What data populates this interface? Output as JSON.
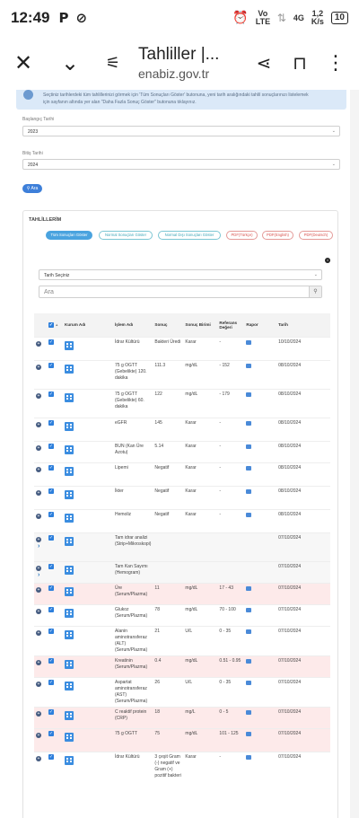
{
  "status_bar": {
    "time": "12:49",
    "left_icons": [
      "P",
      "⊘"
    ],
    "network": "Vo LTE",
    "signal": "4G",
    "speed_value": "1,2",
    "speed_unit": "K/s",
    "battery": "10"
  },
  "browser": {
    "title": "Tahliller |...",
    "url": "enabiz.gov.tr",
    "icons": [
      "close-icon",
      "chevron-down-icon",
      "page-settings-icon",
      "share-icon",
      "bookmark-icon",
      "more-vert-icon"
    ]
  },
  "info": {
    "line1": "Seçtiniz tarihlerdeki tüm tahlillerinizi görmek için 'Tüm Sonuçları Göster' butonuna, yeni tarih aralığındaki tahlil sonuçlarınızı listelemek",
    "line2": "için sayfanın altında yer alan \"Daha Fazla Sonuç Göster\" butonuna tıklayınız."
  },
  "filters": {
    "start_label": "Başlangıç Tarihi",
    "start_value": "2023",
    "end_label": "Bitiş Tarihi",
    "end_value": "2024",
    "search_button": "Ara"
  },
  "panel": {
    "title": "TAHLİLLERİM",
    "tags": [
      "Tüm Sonuçları Göster",
      "Normal Sonuçları Göster",
      "Normal Dışı Sonuçları Göster",
      "PDF(Türkçe)",
      "PDF(English)",
      "PDF(Deutsch)"
    ],
    "date_select": "Tarih Seçiniz",
    "search_placeholder": "Ara"
  },
  "table": {
    "headers": {
      "kurum": "Kurum Adı",
      "islem": "İşlem Adı",
      "sonuc": "Sonuç",
      "birim": "Sonuç Birimi",
      "referans": "Referans Değeri",
      "rapor": "Rapor",
      "tarih": "Tarih"
    },
    "rows": [
      {
        "name": "İdrar Kültürü",
        "result": "Bakteri Üredi",
        "unit": "Karar",
        "ref": "-",
        "date": "10/10/2024",
        "style": ""
      },
      {
        "name": "75 g OGTT (Gebelikte) 120. dakika",
        "result": "111.3",
        "unit": "mg/dL",
        "ref": "- 152",
        "date": "08/10/2024",
        "style": ""
      },
      {
        "name": "75 g OGTT (Gebelikte) 60. dakika",
        "result": "122",
        "unit": "mg/dL",
        "ref": "- 179",
        "date": "08/10/2024",
        "style": ""
      },
      {
        "name": "eGFR",
        "result": "145",
        "unit": "Karar",
        "ref": "-",
        "date": "08/10/2024",
        "style": ""
      },
      {
        "name": "BUN (Kan Üre Azotu)",
        "result": "5.14",
        "unit": "Karar",
        "ref": "-",
        "date": "08/10/2024",
        "style": ""
      },
      {
        "name": "Lipemi",
        "result": "Negatif",
        "unit": "Karar",
        "ref": "-",
        "date": "08/10/2024",
        "style": ""
      },
      {
        "name": "İkter",
        "result": "Negatif",
        "unit": "Karar",
        "ref": "-",
        "date": "08/10/2024",
        "style": ""
      },
      {
        "name": "Hemoliz",
        "result": "Negatif",
        "unit": "Karar",
        "ref": "-",
        "date": "08/10/2024",
        "style": ""
      },
      {
        "name": "Tam idrar analizi (Strip+Mikroskopi)",
        "result": "",
        "unit": "",
        "ref": "",
        "date": "07/10/2024",
        "style": "grey",
        "expand": true
      },
      {
        "name": "Tam Kan Sayımı (Hemogram)",
        "result": "",
        "unit": "",
        "ref": "",
        "date": "07/10/2024",
        "style": "grey",
        "expand": true
      },
      {
        "name": "Üre (Serum/Plazma)",
        "result": "11",
        "unit": "mg/dL",
        "ref": "17 - 43",
        "date": "07/10/2024",
        "style": "pink"
      },
      {
        "name": "Glukoz (Serum/Plazma)",
        "result": "78",
        "unit": "mg/dL",
        "ref": "70 - 100",
        "date": "07/10/2024",
        "style": ""
      },
      {
        "name": "Alanin aminotransferaz (ALT) (Serum/Plazma)",
        "result": "21",
        "unit": "U/L",
        "ref": "0 - 35",
        "date": "07/10/2024",
        "style": ""
      },
      {
        "name": "Kreatinin (Serum/Plazma)",
        "result": "0.4",
        "unit": "mg/dL",
        "ref": "0.51 - 0.95",
        "date": "07/10/2024",
        "style": "pink"
      },
      {
        "name": "Aspartat aminotransferaz (AST) (Serum/Plazma)",
        "result": "26",
        "unit": "U/L",
        "ref": "0 - 35",
        "date": "07/10/2024",
        "style": ""
      },
      {
        "name": "C reaktif protein (CRP)",
        "result": "18",
        "unit": "mg/L",
        "ref": "0 - 5",
        "date": "07/10/2024",
        "style": "pink"
      },
      {
        "name": "75 g OGTT",
        "result": "75",
        "unit": "mg/dL",
        "ref": "101 - 125",
        "date": "07/10/2024",
        "style": "pink"
      },
      {
        "name": "İdrar Kültürü",
        "result": "3 çeşit Gram (-) negatif ve Gram (+) pozitif bakteri",
        "unit": "Karar",
        "ref": "-",
        "date": "07/10/2024",
        "style": ""
      }
    ]
  }
}
